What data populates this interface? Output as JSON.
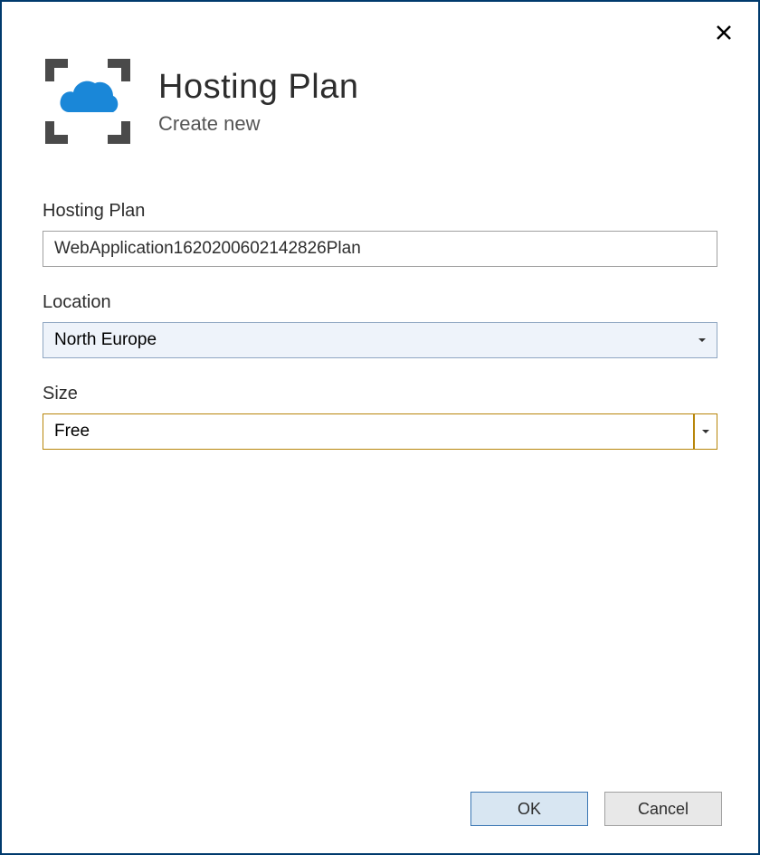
{
  "header": {
    "title": "Hosting Plan",
    "subtitle": "Create new"
  },
  "form": {
    "hosting_plan": {
      "label": "Hosting Plan",
      "value": "WebApplication1620200602142826Plan"
    },
    "location": {
      "label": "Location",
      "value": "North Europe"
    },
    "size": {
      "label": "Size",
      "value": "Free"
    }
  },
  "footer": {
    "ok_label": "OK",
    "cancel_label": "Cancel"
  }
}
